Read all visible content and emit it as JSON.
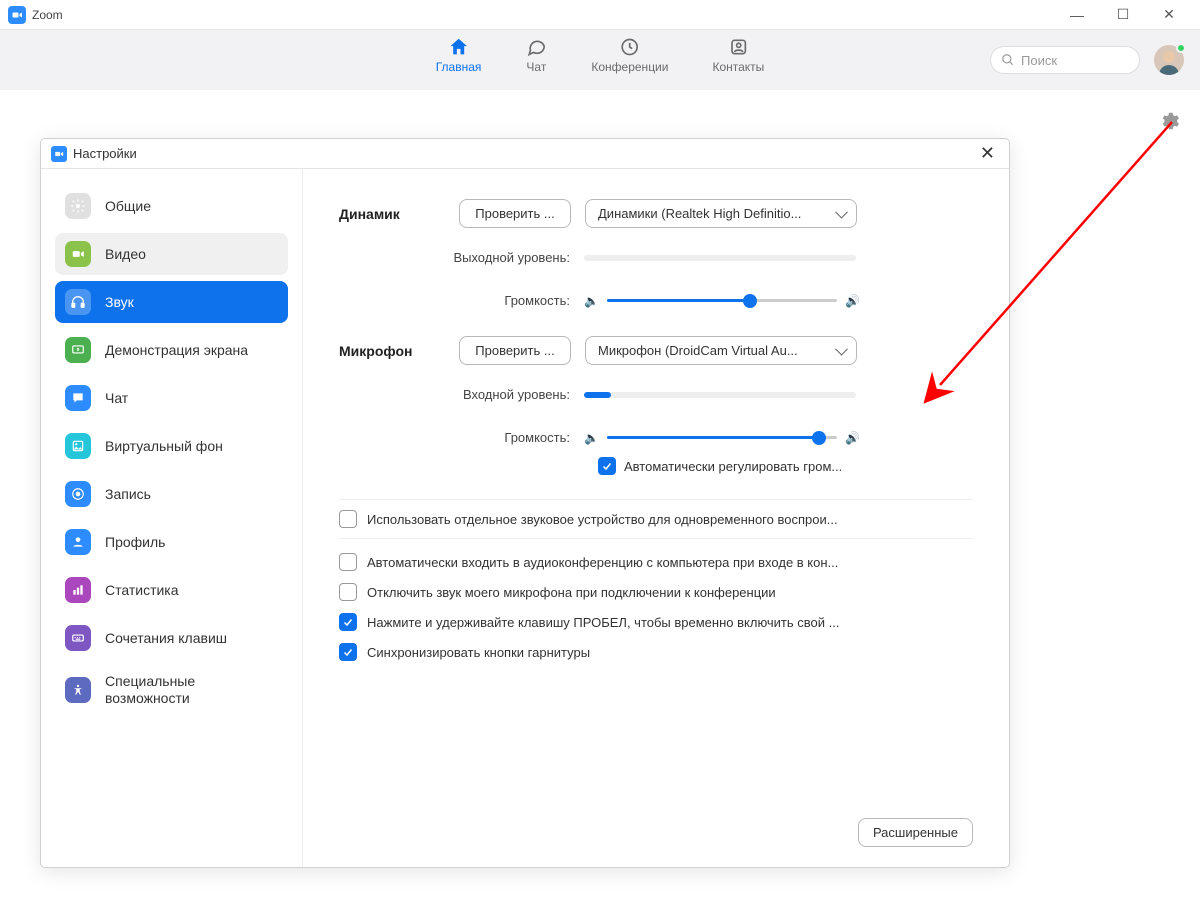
{
  "window": {
    "title": "Zoom"
  },
  "nav": {
    "tabs": [
      {
        "label": "Главная",
        "icon": "home"
      },
      {
        "label": "Чат",
        "icon": "chat"
      },
      {
        "label": "Конференции",
        "icon": "clock"
      },
      {
        "label": "Контакты",
        "icon": "contact"
      }
    ],
    "search_placeholder": "Поиск"
  },
  "dialog": {
    "title": "Настройки",
    "sidebar": [
      {
        "label": "Общие"
      },
      {
        "label": "Видео"
      },
      {
        "label": "Звук"
      },
      {
        "label": "Демонстрация экрана"
      },
      {
        "label": "Чат"
      },
      {
        "label": "Виртуальный фон"
      },
      {
        "label": "Запись"
      },
      {
        "label": "Профиль"
      },
      {
        "label": "Статистика"
      },
      {
        "label": "Сочетания клавиш"
      },
      {
        "label": "Специальные возможности"
      }
    ],
    "audio": {
      "speaker_label": "Динамик",
      "test_button": "Проверить ...",
      "speaker_device": "Динамики (Realtek High Definitio...",
      "output_level_label": "Выходной уровень:",
      "output_level_pct": 0,
      "volume_label": "Громкость:",
      "speaker_volume_pct": 62,
      "mic_label": "Микрофон",
      "mic_device": "Микрофон (DroidCam Virtual Au...",
      "input_level_label": "Входной уровень:",
      "input_level_pct": 10,
      "mic_volume_pct": 92,
      "auto_adjust": "Автоматически регулировать гром...",
      "auto_adjust_checked": true,
      "separate_device": "Использовать отдельное звуковое устройство для одновременного воспрои...",
      "separate_device_checked": false,
      "options": [
        {
          "label": "Автоматически входить в аудиоконференцию с компьютера при входе в кон...",
          "checked": false
        },
        {
          "label": "Отключить звук моего микрофона при подключении к конференции",
          "checked": false
        },
        {
          "label": "Нажмите и удерживайте клавишу ПРОБЕЛ, чтобы временно включить свой ...",
          "checked": true
        },
        {
          "label": "Синхронизировать кнопки гарнитуры",
          "checked": true
        }
      ],
      "advanced_button": "Расширенные"
    }
  }
}
